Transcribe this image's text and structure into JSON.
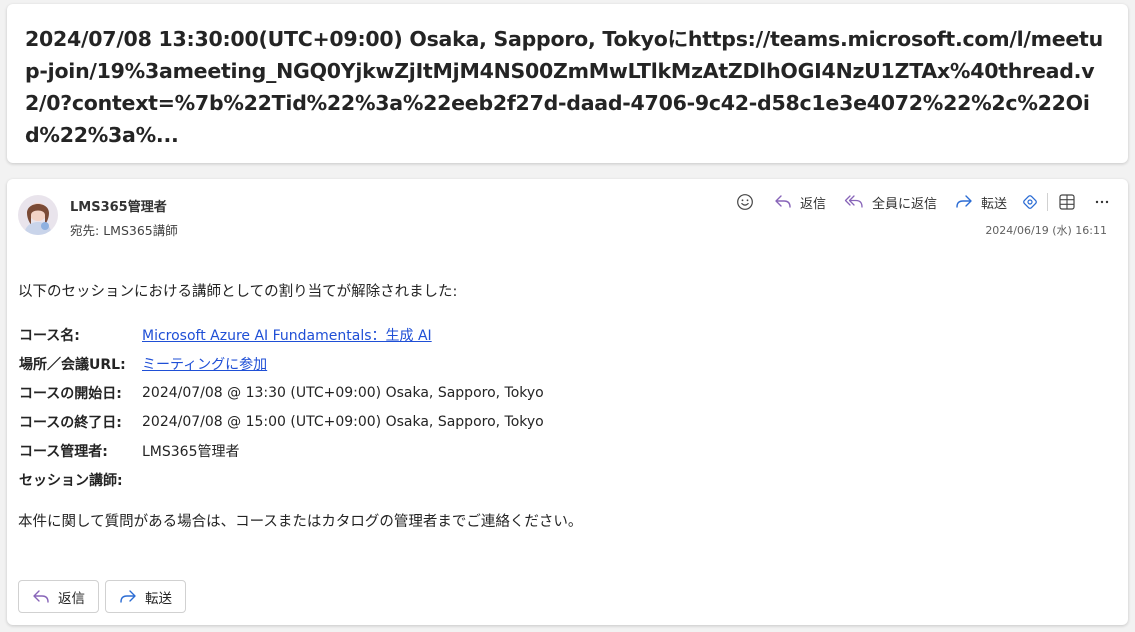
{
  "subject": "2024/07/08 13:30:00(UTC+09:00) Osaka, Sapporo, Tokyoにhttps://teams.microsoft.com/l/meetup-join/19%3ameeting_NGQ0YjkwZjItMjM4NS00ZmMwLTlkMzAtZDlhOGI4NzU1ZTAx%40thread.v2/0?context=%7b%22Tid%22%3a%22eeb2f27d-daad-4706-9c42-d58c1e3e4072%22%2c%22Oid%22%3a%...",
  "message": {
    "sender": "LMS365管理者",
    "to_prefix": "宛先:",
    "to": "LMS365講師",
    "date": "2024/06/19 (水) 16:11",
    "avatar_icon": "user-photo-avatar"
  },
  "toolbar": {
    "emoji_icon": "smiley-icon",
    "reply": "返信",
    "reply_all": "全員に返信",
    "forward": "転送",
    "accent_purple": "#8764b8",
    "accent_blue": "#2b6cd4"
  },
  "body": {
    "intro": "以下のセッションにおける講師としての割り当てが解除されました:",
    "rows": [
      {
        "key": "コース名:",
        "value": "Microsoft Azure AI Fundamentals：生成 AI"
      },
      {
        "key": "場所／会議URL:",
        "value": "ミーティングに参加"
      },
      {
        "key": "コースの開始日:",
        "value": "2024/07/08 @ 13:30 (UTC+09:00) Osaka, Sapporo, Tokyo"
      },
      {
        "key": "コースの終了日:",
        "value": "2024/07/08 @ 15:00 (UTC+09:00) Osaka, Sapporo, Tokyo"
      },
      {
        "key": "コース管理者:",
        "value": "LMS365管理者"
      },
      {
        "key": "セッション講師:",
        "value": ""
      }
    ],
    "closing": "本件に関して質問がある場合は、コースまたはカタログの管理者までご連絡ください。",
    "link_color": "#1f4fd6"
  },
  "actions": {
    "reply": "返信",
    "forward": "転送"
  }
}
